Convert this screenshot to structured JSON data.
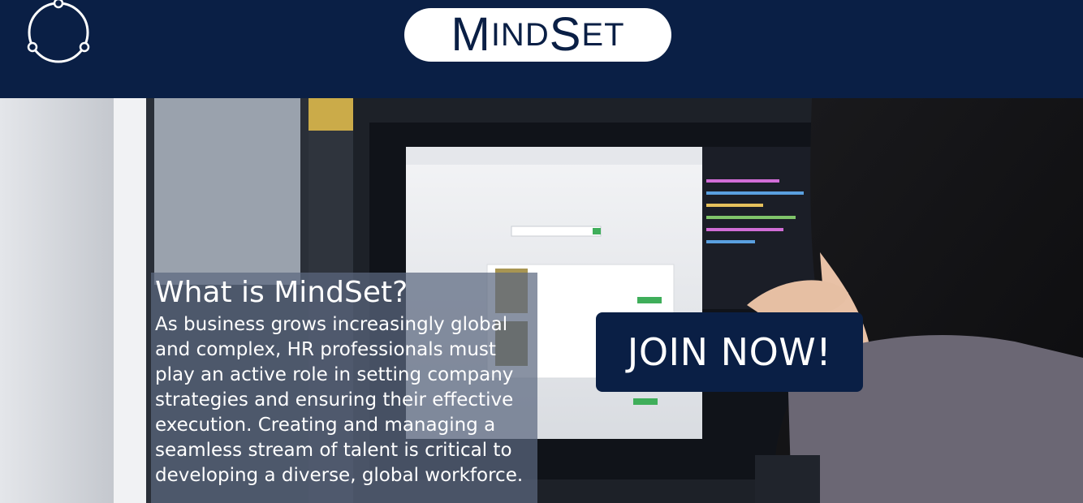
{
  "header": {
    "brand_first": "M",
    "brand_rest_1": "IND",
    "brand_second": "S",
    "brand_rest_2": "ET",
    "logo_icon": "orbit-circle-icon"
  },
  "hero": {
    "about_title": "What is MindSet?",
    "about_body": "As business grows increasingly global and complex, HR professionals must play an active role in setting company strategies and ensuring their effective execution. Creating and managing a seamless stream of talent is critical to developing a diverse, global workforce.",
    "join_label": "JOIN NOW!"
  },
  "colors": {
    "navy": "#0a1f45",
    "white": "#ffffff"
  }
}
